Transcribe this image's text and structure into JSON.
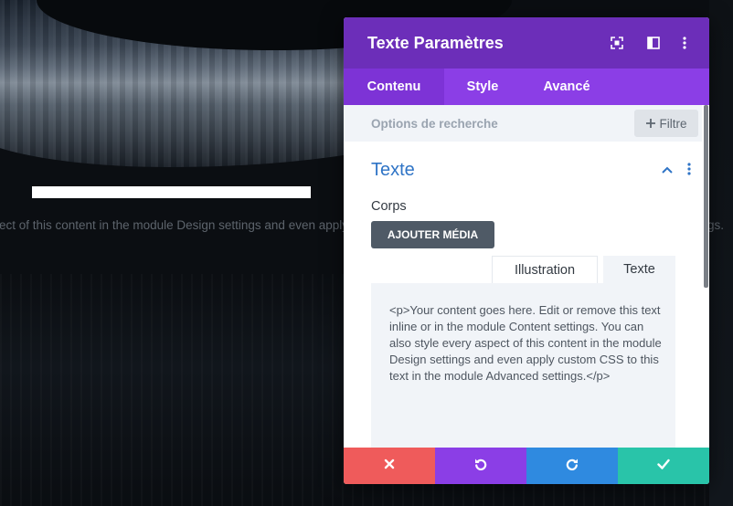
{
  "background": {
    "body_text": "ect of this content in the module Design settings and even apply custom CSS to this text in the module Advanced settings.",
    "body_text_tail": "gs."
  },
  "modal": {
    "title": "Texte Paramètres",
    "header_icons": [
      "expand-icon",
      "sidebar-layout-icon",
      "more-vertical-icon"
    ],
    "tabs": [
      {
        "label": "Contenu",
        "active": true
      },
      {
        "label": "Style",
        "active": false
      },
      {
        "label": "Avancé",
        "active": false
      }
    ],
    "search": {
      "placeholder": "Options de recherche",
      "value": ""
    },
    "filter": {
      "label": "Filtre",
      "icon": "plus-icon"
    },
    "section": {
      "title": "Texte",
      "expanded": true
    },
    "field_label": "Corps",
    "add_media_label": "AJOUTER MÉDIA",
    "editor_tabs": [
      {
        "label": "Illustration",
        "active": false
      },
      {
        "label": "Texte",
        "active": true
      }
    ],
    "editor_content": "<p>Your content goes here. Edit or remove this text inline or in the module Content settings. You can also style every aspect of this content in the module Design settings and even apply custom CSS to this text in the module Advanced settings.</p>",
    "footer_buttons": [
      {
        "action": "cancel",
        "icon": "close-icon",
        "color": "#ef5b5b"
      },
      {
        "action": "undo",
        "icon": "undo-icon",
        "color": "#8b3ee6"
      },
      {
        "action": "redo",
        "icon": "redo-icon",
        "color": "#2f8ae0"
      },
      {
        "action": "save",
        "icon": "check-icon",
        "color": "#29c4a9"
      }
    ]
  },
  "colors": {
    "header": "#6c2eb9",
    "tabs": "#8b3ee6",
    "accent_blue": "#2f74c6",
    "search_bg": "#f1f4f8"
  }
}
